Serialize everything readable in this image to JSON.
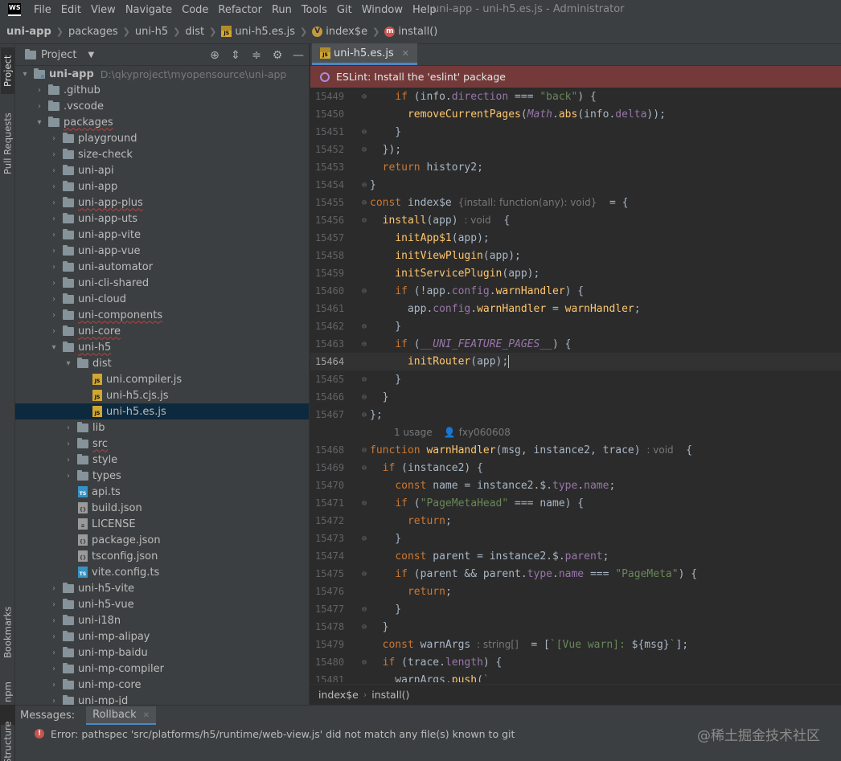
{
  "menubar": {
    "logo": "WS",
    "items": [
      "File",
      "Edit",
      "View",
      "Navigate",
      "Code",
      "Refactor",
      "Run",
      "Tools",
      "Git",
      "Window",
      "Help"
    ],
    "window_title": "uni-app - uni-h5.es.js - Administrator"
  },
  "breadcrumb": [
    "uni-app",
    "packages",
    "uni-h5",
    "dist",
    "uni-h5.es.js",
    "index$e",
    "install()"
  ],
  "left_stripe": {
    "project": "Project",
    "pull_requests": "Pull Requests",
    "bookmarks": "Bookmarks",
    "npm": "npm",
    "structure": "Structure"
  },
  "project_panel": {
    "title": "Project",
    "tree": [
      {
        "label": "uni-app",
        "path": "D:\\qkyproject\\myopensource\\uni-app"
      },
      {
        "label": ".github"
      },
      {
        "label": ".vscode"
      },
      {
        "label": "packages"
      },
      {
        "label": "playground"
      },
      {
        "label": "size-check"
      },
      {
        "label": "uni-api"
      },
      {
        "label": "uni-app"
      },
      {
        "label": "uni-app-plus"
      },
      {
        "label": "uni-app-uts"
      },
      {
        "label": "uni-app-vite"
      },
      {
        "label": "uni-app-vue"
      },
      {
        "label": "uni-automator"
      },
      {
        "label": "uni-cli-shared"
      },
      {
        "label": "uni-cloud"
      },
      {
        "label": "uni-components"
      },
      {
        "label": "uni-core"
      },
      {
        "label": "uni-h5"
      },
      {
        "label": "dist"
      },
      {
        "label": "uni.compiler.js"
      },
      {
        "label": "uni-h5.cjs.js"
      },
      {
        "label": "uni-h5.es.js"
      },
      {
        "label": "lib"
      },
      {
        "label": "src"
      },
      {
        "label": "style"
      },
      {
        "label": "types"
      },
      {
        "label": "api.ts"
      },
      {
        "label": "build.json"
      },
      {
        "label": "LICENSE"
      },
      {
        "label": "package.json"
      },
      {
        "label": "tsconfig.json"
      },
      {
        "label": "vite.config.ts"
      },
      {
        "label": "uni-h5-vite"
      },
      {
        "label": "uni-h5-vue"
      },
      {
        "label": "uni-i18n"
      },
      {
        "label": "uni-mp-alipay"
      },
      {
        "label": "uni-mp-baidu"
      },
      {
        "label": "uni-mp-compiler"
      },
      {
        "label": "uni-mp-core"
      },
      {
        "label": "uni-mp-jd"
      }
    ]
  },
  "editor": {
    "tab": "uni-h5.es.js",
    "eslint_banner": "ESLint: Install the 'eslint' package",
    "lines": {
      "l15449": "15449",
      "l15450": "15450",
      "l15451": "15451",
      "l15452": "15452",
      "l15453": "15453",
      "l15454": "15454",
      "l15455": "15455",
      "l15456": "15456",
      "l15457": "15457",
      "l15458": "15458",
      "l15459": "15459",
      "l15460": "15460",
      "l15461": "15461",
      "l15462": "15462",
      "l15463": "15463",
      "l15464": "15464",
      "l15465": "15465",
      "l15466": "15466",
      "l15467": "15467",
      "l15468": "15468",
      "l15469": "15469",
      "l15470": "15470",
      "l15471": "15471",
      "l15472": "15472",
      "l15473": "15473",
      "l15474": "15474",
      "l15475": "15475",
      "l15476": "15476",
      "l15477": "15477",
      "l15478": "15478",
      "l15479": "15479",
      "l15480": "15480",
      "l15481": "15481"
    },
    "hints": {
      "index_type": "{install: function(any): void}",
      "void1": ": void",
      "void2": ": void",
      "string_arr": ": string[]"
    },
    "usage": "1 usage",
    "author": "fxy060608",
    "crumbs": [
      "index$e",
      "install()"
    ]
  },
  "messages": {
    "title": "Messages:",
    "tab": "Rollback",
    "error": "Error: pathspec 'src/platforms/h5/runtime/web-view.js' did not match any file(s) known to git",
    "watermark": "@稀土掘金技术社区"
  }
}
